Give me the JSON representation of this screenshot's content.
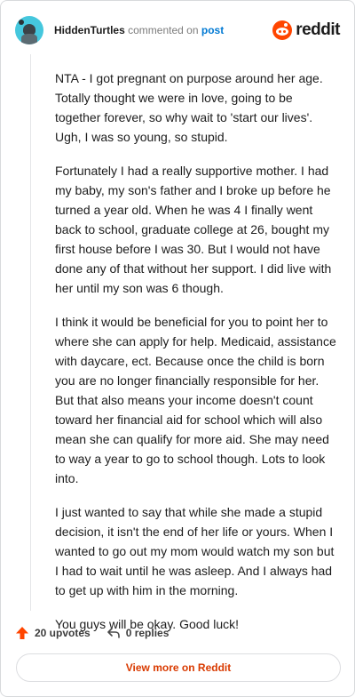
{
  "header": {
    "username": "HiddenTurtles",
    "commented_on": "commented on",
    "post_link": "post",
    "logo_text": "reddit",
    "brand_color": "#ff4500",
    "avatar_icon": "snoo-avatar-icon"
  },
  "comment": {
    "paragraphs": [
      "NTA - I got pregnant on purpose around her age. Totally thought we were in love, going to be together forever, so why wait to 'start our lives'. Ugh, I was so young, so stupid.",
      "Fortunately I had a really supportive mother. I had my baby, my son's father and I broke up before he turned a year old. When he was 4 I finally went back to school, graduate college at 26, bought my first house before I was 30. But I would not have done any of that without her support. I did live with her until my son was 6 though.",
      "I think it would be beneficial for you to point her to where she can apply for help. Medicaid, assistance with daycare, ect. Because once the child is born you are no longer financially responsible for her. But that also means your income doesn't count toward her financial aid for school which will also mean she can qualify for more aid. She may need to way a year to go to school though. Lots to look into.",
      "I just wanted to say that while she made a stupid decision, it isn't the end of her life or yours. When I wanted to go out my mom would watch my son but I had to wait until he was asleep. And I always had to get up with him in the morning.",
      "You guys will be okay. Good luck!"
    ]
  },
  "actions": {
    "upvotes": "20 upvotes",
    "replies": "0 replies",
    "upvote_icon": "upvote-arrow-icon",
    "reply_icon": "reply-icon"
  },
  "footer": {
    "view_more": "View more on Reddit"
  }
}
